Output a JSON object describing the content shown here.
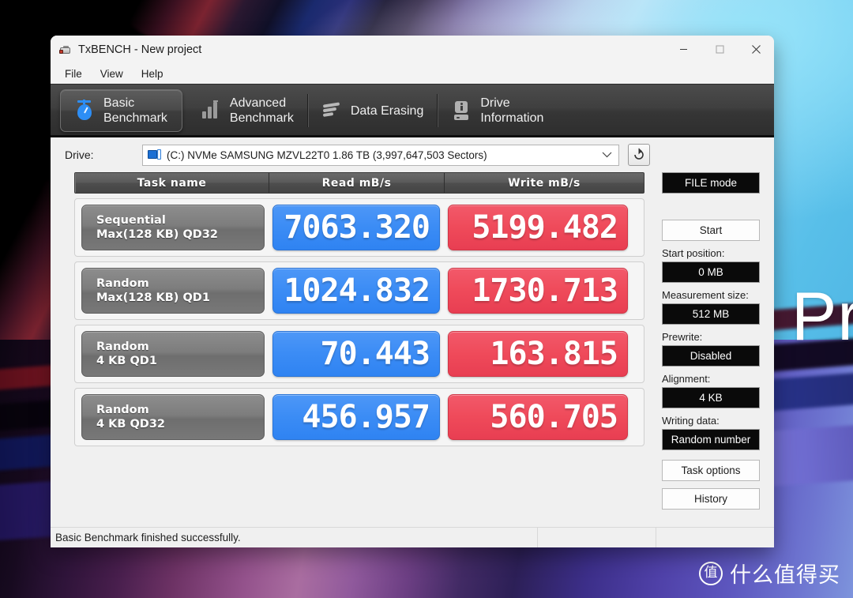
{
  "wallpaper": {
    "text": "Pr"
  },
  "watermark": {
    "logo_char": "值",
    "text": "什么值得买"
  },
  "window": {
    "title": "TxBENCH - New project",
    "icon": "app-icon",
    "controls": {
      "minimize": "minimize-icon",
      "maximize": "maximize-icon",
      "close": "close-icon"
    }
  },
  "menubar": {
    "items": [
      {
        "label": "File"
      },
      {
        "label": "View"
      },
      {
        "label": "Help"
      }
    ]
  },
  "tabs": [
    {
      "label": "Basic\nBenchmark",
      "icon": "timer-icon",
      "active": true
    },
    {
      "label": "Advanced\nBenchmark",
      "icon": "bar-chart-icon",
      "active": false
    },
    {
      "label": "Data Erasing",
      "icon": "eraser-icon",
      "active": false
    },
    {
      "label": "Drive\nInformation",
      "icon": "drive-info-icon",
      "active": false
    }
  ],
  "drive": {
    "label": "Drive:",
    "selected": "(C:) NVMe SAMSUNG MZVL22T0  1.86 TB (3,997,647,503 Sectors)",
    "icon": "disk-icon",
    "caret": "chevron-down-icon",
    "refresh_icon": "refresh-icon"
  },
  "table": {
    "headers": {
      "task": "Task name",
      "read": "Read mB/s",
      "write": "Write mB/s"
    },
    "rows": [
      {
        "task_line1": "Sequential",
        "task_line2": "Max(128 KB) QD32",
        "read": "7063.320",
        "write": "5199.482"
      },
      {
        "task_line1": "Random",
        "task_line2": "Max(128 KB) QD1",
        "read": "1024.832",
        "write": "1730.713"
      },
      {
        "task_line1": "Random",
        "task_line2": "4 KB QD1",
        "read": "70.443",
        "write": "163.815"
      },
      {
        "task_line1": "Random",
        "task_line2": "4 KB QD32",
        "read": "456.957",
        "write": "560.705"
      }
    ]
  },
  "sidebar": {
    "mode_button": "FILE mode",
    "start_button": "Start",
    "start_position_label": "Start position:",
    "start_position_value": "0 MB",
    "measurement_size_label": "Measurement size:",
    "measurement_size_value": "512 MB",
    "prewrite_label": "Prewrite:",
    "prewrite_value": "Disabled",
    "alignment_label": "Alignment:",
    "alignment_value": "4 KB",
    "writing_data_label": "Writing data:",
    "writing_data_value": "Random number",
    "task_options_button": "Task options",
    "history_button": "History"
  },
  "statusbar": {
    "message": "Basic Benchmark finished successfully."
  },
  "colors": {
    "read_accent": "#3b8cf5",
    "write_accent": "#ef4a5a",
    "tab_bar": "#3f3f3f",
    "task_cell": "#7d7d7d",
    "dark_field": "#0a0a0a"
  }
}
